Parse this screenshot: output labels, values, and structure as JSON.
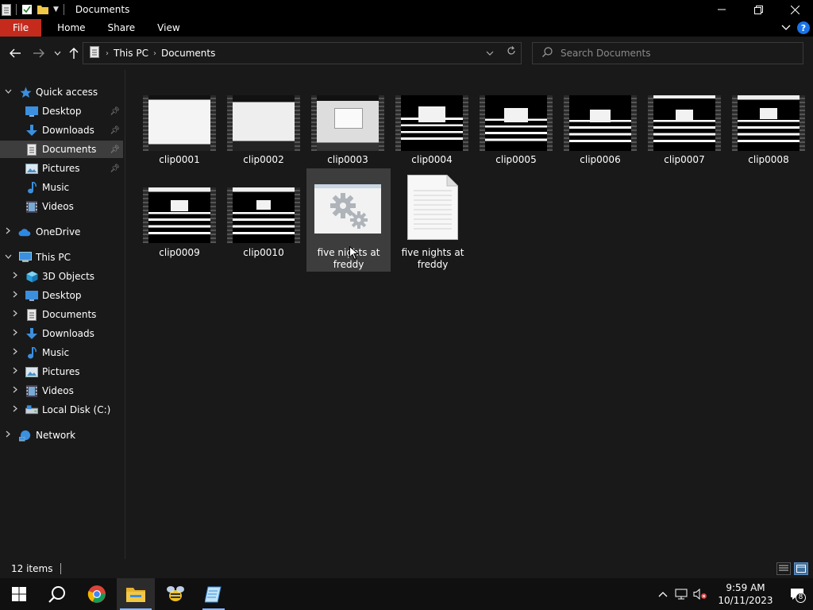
{
  "window": {
    "title": "Documents"
  },
  "ribbon": {
    "tabs": [
      "File",
      "Home",
      "Share",
      "View"
    ]
  },
  "address": {
    "crumbs": [
      "This PC",
      "Documents"
    ]
  },
  "search": {
    "placeholder": "Search Documents"
  },
  "navpane": {
    "quick_access": "Quick access",
    "quick_items": [
      "Desktop",
      "Downloads",
      "Documents",
      "Pictures",
      "Music",
      "Videos"
    ],
    "onedrive": "OneDrive",
    "this_pc": "This PC",
    "pc_items": [
      "3D Objects",
      "Desktop",
      "Documents",
      "Downloads",
      "Music",
      "Pictures",
      "Videos",
      "Local Disk (C:)"
    ],
    "network": "Network"
  },
  "files": [
    {
      "name": "clip0001",
      "type": "video"
    },
    {
      "name": "clip0002",
      "type": "video"
    },
    {
      "name": "clip0003",
      "type": "video"
    },
    {
      "name": "clip0004",
      "type": "video"
    },
    {
      "name": "clip0005",
      "type": "video"
    },
    {
      "name": "clip0006",
      "type": "video"
    },
    {
      "name": "clip0007",
      "type": "video"
    },
    {
      "name": "clip0008",
      "type": "video"
    },
    {
      "name": "clip0009",
      "type": "video"
    },
    {
      "name": "clip0010",
      "type": "video"
    },
    {
      "name": "five nights at freddy",
      "type": "app"
    },
    {
      "name": "five nights at freddy",
      "type": "text"
    }
  ],
  "status": {
    "count": "12 items"
  },
  "clock": {
    "time": "9:59 AM",
    "date": "10/11/2023"
  },
  "notifications": {
    "count": "8"
  },
  "colors": {
    "file_tab": "#c42b1c",
    "selection": "#3d3d3d",
    "folder": "#f3c746",
    "blue": "#3b8fde"
  }
}
